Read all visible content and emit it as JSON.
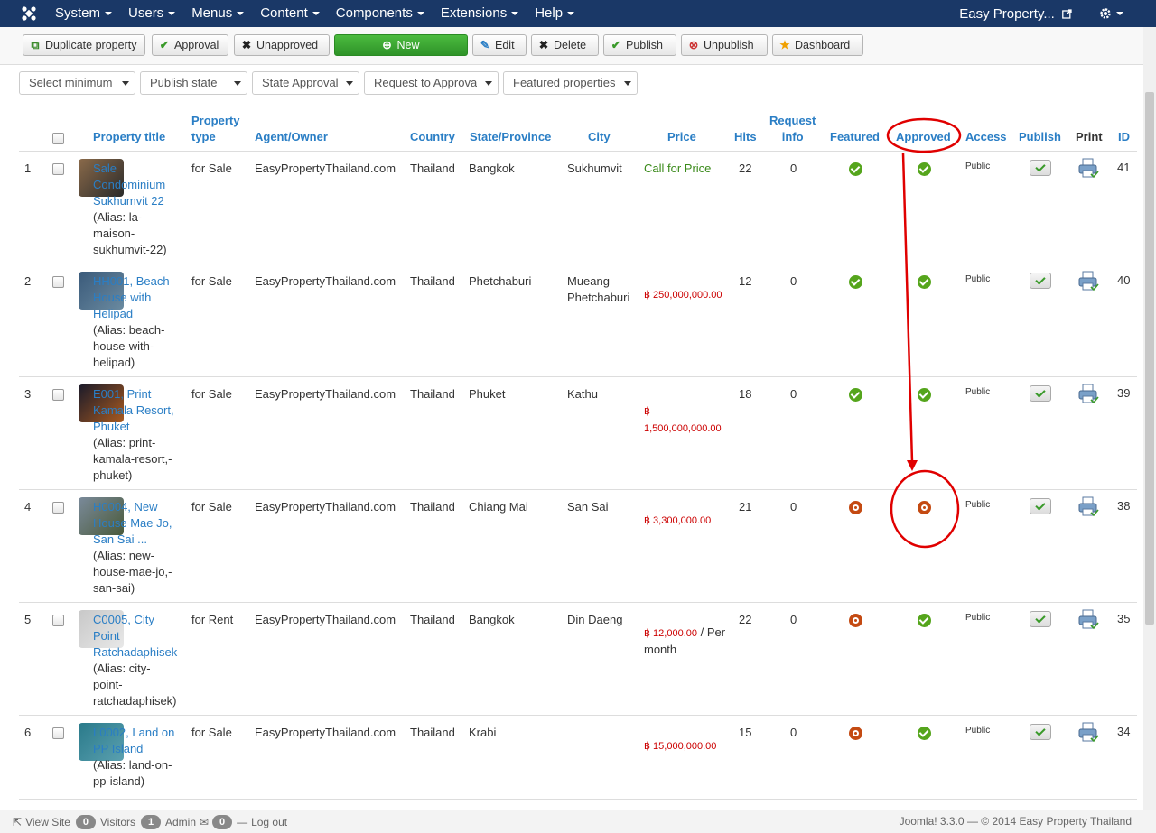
{
  "navbar": {
    "menu": [
      "System",
      "Users",
      "Menus",
      "Content",
      "Components",
      "Extensions",
      "Help"
    ],
    "site_name": "Easy Property..."
  },
  "toolbar": {
    "duplicate": "Duplicate property",
    "approval": "Approval",
    "unapproved": "Unapproved",
    "new": "New",
    "edit": "Edit",
    "delete": "Delete",
    "publish": "Publish",
    "unpublish": "Unpublish",
    "dashboard": "Dashboard"
  },
  "filters": {
    "min": "Select minimum",
    "publish_state": "Publish state",
    "state_approval": "State Approval",
    "request_approval": "Request to Approval",
    "featured": "Featured properties"
  },
  "columns": {
    "title": "Property title",
    "type_1": "Property",
    "type_2": "type",
    "agent": "Agent/Owner",
    "country": "Country",
    "state": "State/Province",
    "city": "City",
    "price": "Price",
    "hits": "Hits",
    "request_1": "Request",
    "request_2": "info",
    "featured": "Featured",
    "approved": "Approved",
    "access": "Access",
    "publish": "Publish",
    "print": "Print",
    "id": "ID"
  },
  "rows": [
    {
      "num": "1",
      "title": "Sale Condominium Sukhumvit 22",
      "alias": "(Alias: la-maison-sukhumvit-22)",
      "type": "for Sale",
      "agent": "EasyPropertyThailand.com",
      "country": "Thailand",
      "state": "Bangkok",
      "city": "Sukhumvit",
      "price": "Call for Price",
      "hits": "22",
      "request": "0",
      "featured": true,
      "approved": true,
      "access": "Public",
      "id": "41"
    },
    {
      "num": "2",
      "title": "HH001, Beach House with Helipad",
      "alias": "(Alias: beach-house-with-helipad)",
      "type": "for Sale",
      "agent": "EasyPropertyThailand.com",
      "country": "Thailand",
      "state": "Phetchaburi",
      "city": "Mueang Phetchaburi",
      "price": "฿ 250,000,000.00",
      "hits": "12",
      "request": "0",
      "featured": true,
      "approved": true,
      "access": "Public",
      "id": "40"
    },
    {
      "num": "3",
      "title": "E001, Print Kamala Resort, Phuket",
      "alias": "(Alias: print-kamala-resort,-phuket)",
      "type": "for Sale",
      "agent": "EasyPropertyThailand.com",
      "country": "Thailand",
      "state": "Phuket",
      "city": "Kathu",
      "price": "฿ 1,500,000,000.00",
      "hits": "18",
      "request": "0",
      "featured": true,
      "approved": true,
      "access": "Public",
      "id": "39"
    },
    {
      "num": "4",
      "title": "H0004, New House Mae Jo, San Sai ...",
      "alias": "(Alias: new-house-mae-jo,-san-sai)",
      "type": "for Sale",
      "agent": "EasyPropertyThailand.com",
      "country": "Thailand",
      "state": "Chiang Mai",
      "city": "San Sai",
      "price": "฿ 3,300,000.00",
      "hits": "21",
      "request": "0",
      "featured": false,
      "approved": false,
      "access": "Public",
      "id": "38"
    },
    {
      "num": "5",
      "title": "C0005, City Point Ratchadaphisek",
      "alias": "(Alias: city-point-ratchadaphisek)",
      "type": "for Rent",
      "agent": "EasyPropertyThailand.com",
      "country": "Thailand",
      "state": "Bangkok",
      "city": "Din Daeng",
      "price": "฿ 12,000.00",
      "price_suffix": " / Per month",
      "hits": "22",
      "request": "0",
      "featured": false,
      "approved": true,
      "access": "Public",
      "id": "35"
    },
    {
      "num": "6",
      "title": "L0002, Land on PP Island",
      "alias": "(Alias: land-on-pp-island)",
      "type": "for Sale",
      "agent": "EasyPropertyThailand.com",
      "country": "Thailand",
      "state": "Krabi",
      "city": "",
      "price": "฿ 15,000,000.00",
      "hits": "15",
      "request": "0",
      "featured": false,
      "approved": true,
      "access": "Public",
      "id": "34"
    }
  ],
  "footer": {
    "view_site": "View Site",
    "visitors_count": "0",
    "visitors": "Visitors",
    "admin_count": "1",
    "admin": "Admin",
    "messages_count": "0",
    "logout": "Log out",
    "copyright": "Joomla! 3.3.0 — © 2014 Easy Property Thailand"
  },
  "colors": {
    "navbar": "#1a3867",
    "link": "#2a7ec5",
    "annotation": "#e00000"
  }
}
